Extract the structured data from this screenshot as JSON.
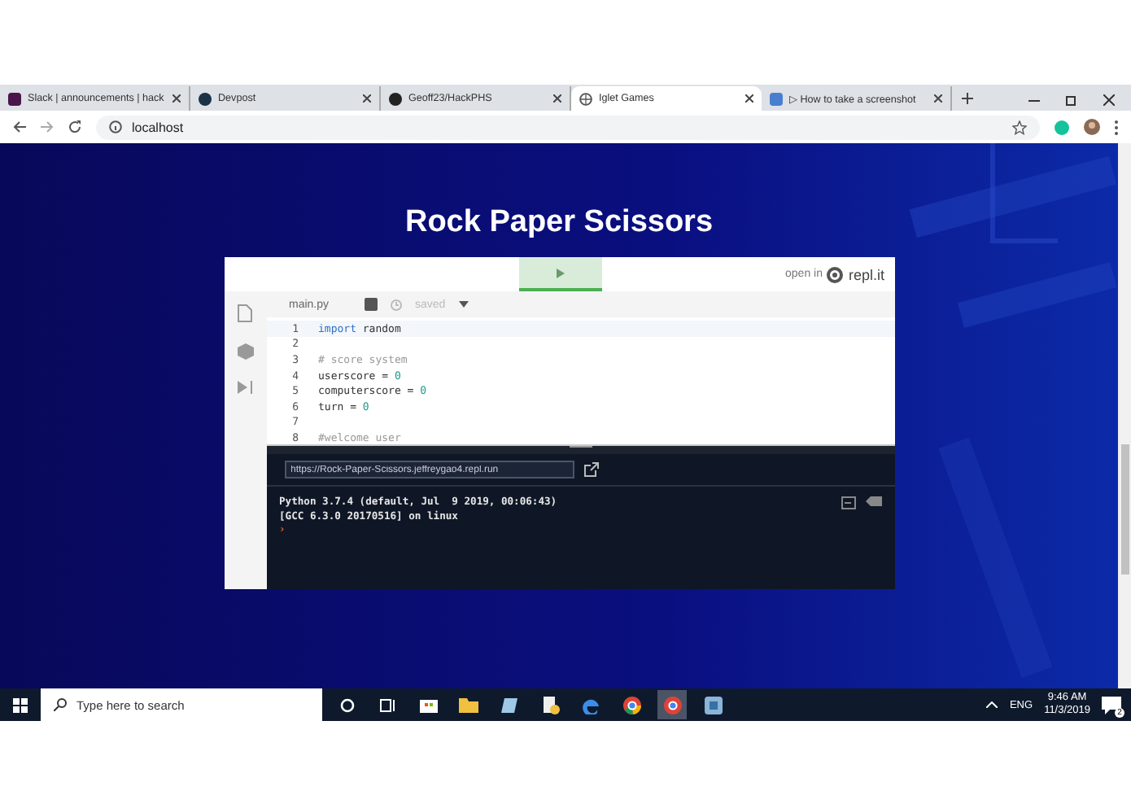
{
  "tabs": [
    {
      "label": "Slack | announcements | hack",
      "selected": false
    },
    {
      "label": "Devpost",
      "selected": false
    },
    {
      "label": "Geoff23/HackPHS",
      "selected": false
    },
    {
      "label": "Iglet Games",
      "selected": true
    },
    {
      "label": "▷ How to take a screenshot",
      "selected": false
    }
  ],
  "address": "localhost",
  "page": {
    "title": "Rock Paper Scissors",
    "embed": {
      "open_in": "open in",
      "brand": "repl.it",
      "file": "main.py",
      "saved": "saved",
      "code": [
        {
          "number": "1",
          "tokens": [
            {
              "text": "import",
              "kind": "keyword"
            },
            {
              "text": " random",
              "kind": "plain"
            }
          ]
        },
        {
          "number": "2"
        },
        {
          "number": "3",
          "tokens": [
            {
              "text": "# score system",
              "kind": "comment"
            }
          ]
        },
        {
          "number": "4",
          "tokens": [
            {
              "text": "userscore = ",
              "kind": "plain"
            },
            {
              "text": "0",
              "kind": "number"
            }
          ]
        },
        {
          "number": "5",
          "tokens": [
            {
              "text": "computerscore = ",
              "kind": "plain"
            },
            {
              "text": "0",
              "kind": "number"
            }
          ]
        },
        {
          "number": "6",
          "tokens": [
            {
              "text": "turn = ",
              "kind": "plain"
            },
            {
              "text": "0",
              "kind": "number"
            }
          ]
        },
        {
          "number": "7"
        },
        {
          "number": "8",
          "tokens": [
            {
              "text": "#welcome user",
              "kind": "comment"
            }
          ]
        }
      ],
      "url": "https://Rock-Paper-Scissors.jeffreygao4.repl.run",
      "console": [
        "Python 3.7.4 (default, Jul  9 2019, 00:06:43)",
        "[GCC 6.3.0 20170516] on linux"
      ],
      "prompt": "›"
    }
  },
  "taskbar": {
    "search_placeholder": "Type here to search",
    "lang": "ENG",
    "time": "9:46 AM",
    "date": "11/3/2019",
    "notifications": "2"
  }
}
